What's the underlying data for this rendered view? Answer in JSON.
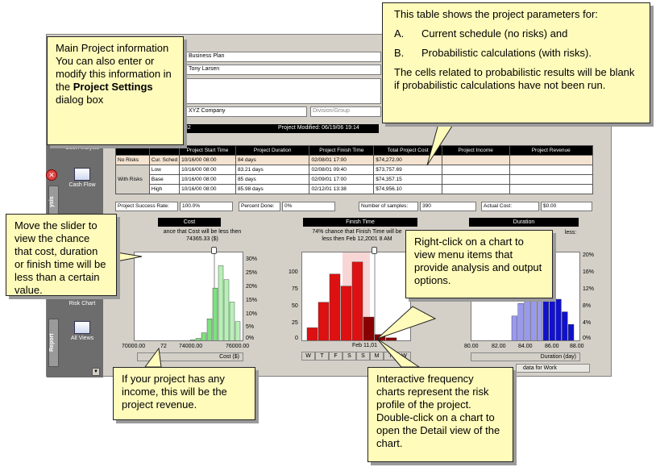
{
  "project": {
    "title": "Business Plan",
    "manager": "Tony Larsen",
    "company": "XYZ Company",
    "division_label": "Division/Group",
    "time_left": "32",
    "modified": "Project Modified: 06/19/06 19:14"
  },
  "sidebar": {
    "tab_analysis": "ysis",
    "tab_report": "Report",
    "items": [
      {
        "label": "Cost Analysis"
      },
      {
        "label": "Cash Flow"
      },
      {
        "label": "Risk Chart"
      },
      {
        "label": "All Views"
      }
    ]
  },
  "param_table": {
    "headers": [
      "",
      "",
      "Project Start Time",
      "Project Duration",
      "Project Finish Time",
      "Total Project Cost",
      "Project Income",
      "Project Revenue"
    ],
    "group_no_risks": "No Risks",
    "group_with_risks": "With Risks",
    "rows": [
      {
        "label": "Cur. Sched",
        "start": "10/16/00 08:00",
        "duration": "84 days",
        "finish": "02/08/01 17:00",
        "cost": "$74,272.00",
        "income": "",
        "revenue": ""
      },
      {
        "label": "Low",
        "start": "10/16/00 08:00",
        "duration": "83.21 days",
        "finish": "02/08/01 09:40",
        "cost": "$73,757.69",
        "income": "",
        "revenue": ""
      },
      {
        "label": "Base",
        "start": "10/16/00 08:00",
        "duration": "85 days",
        "finish": "02/09/01 17:00",
        "cost": "$74,357.15",
        "income": "",
        "revenue": ""
      },
      {
        "label": "High",
        "start": "10/16/00 08:00",
        "duration": "85.98 days",
        "finish": "02/12/01 13:38",
        "cost": "$74,956.10",
        "income": "",
        "revenue": ""
      }
    ]
  },
  "summary": {
    "success_label": "Project Success Rate:",
    "success_value": "100.0%",
    "percent_label": "Percent Done:",
    "percent_value": "0%",
    "samples_label": "Number of samples:",
    "samples_value": "390",
    "actual_label": "Actual Cost:",
    "actual_value": "$0.00"
  },
  "charts": {
    "cost": {
      "title": "Cost",
      "caption_line1": "ance that Cost will be less then",
      "caption_line2": "74365.33 ($)",
      "xlabel": "Cost ($)",
      "xticks": [
        "70000.00",
        "72",
        "74000.00",
        "76000.00"
      ],
      "yticks_right": [
        "30%",
        "25%",
        "20%",
        "15%",
        "10%",
        "5%",
        "0%"
      ],
      "values": [
        0.2,
        0.5,
        1,
        3,
        8,
        19,
        27,
        22,
        14,
        7
      ]
    },
    "finish": {
      "title": "Finish Time",
      "caption_line1": "74% chance that Finish Time will be",
      "caption_line2": "less then Feb 12,2001 8 AM",
      "xlabel": "Feb 11,01",
      "day_labels": [
        "W",
        "T",
        "F",
        "S",
        "S",
        "M",
        "T",
        "W"
      ],
      "yticks_left": [
        "100",
        "75",
        "50",
        "25",
        "0"
      ],
      "values": [
        20,
        58,
        100,
        82,
        118,
        36,
        10,
        5
      ]
    },
    "duration": {
      "title": "Duration",
      "caption_line1": "less:",
      "xlabel": "Duration (day)",
      "xticks": [
        "80.00",
        "82.00",
        "84.00",
        "86.00",
        "88.00"
      ],
      "yticks_right": [
        "20%",
        "16%",
        "12%",
        "8%",
        "4%",
        "0%"
      ],
      "values": [
        6,
        9,
        11,
        13,
        15,
        14,
        12,
        10,
        7,
        4
      ]
    }
  },
  "update_button": "data for Work",
  "callouts": {
    "main_info": {
      "text_before": "Main Project information You can also enter or modify this information in the ",
      "bold": "Project Settings",
      "text_after": " dialog box"
    },
    "table_info": {
      "intro": "This table shows the project parameters for:",
      "item_a_letter": "A.",
      "item_a": "Current schedule (no risks) and",
      "item_b_letter": "B.",
      "item_b": "Probabilistic calculations (with risks).",
      "outro": "The cells related to probabilistic results will be blank if probabilistic calculations have not been run."
    },
    "slider": "Move the slider to view the chance that cost, duration or finish time will be less than a certain value.",
    "right_click": "Right-click on a chart to view menu items that provide analysis and output options.",
    "income": "If your project has any income, this will be the project revenue.",
    "frequency": "Interactive frequency charts represent the risk profile of the project. Double-click on a chart to open the Detail view of the chart."
  }
}
